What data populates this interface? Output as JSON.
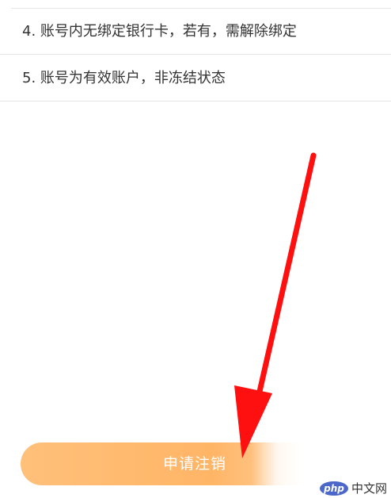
{
  "requirements": {
    "item4": "4. 账号内无绑定银行卡，若有，需解除绑定",
    "item5": "5. 账号为有效账户，非冻结状态"
  },
  "apply_button": {
    "label": "申请注销"
  },
  "watermark": {
    "logo": "php",
    "text": "中文网"
  },
  "colors": {
    "button_start": "#ffc07a",
    "button_end": "#ffe3c4",
    "arrow": "#ff1010",
    "text": "#333333",
    "divider": "#e6e6e6"
  },
  "icons": {
    "arrow": "red-arrow-pointing-down"
  }
}
